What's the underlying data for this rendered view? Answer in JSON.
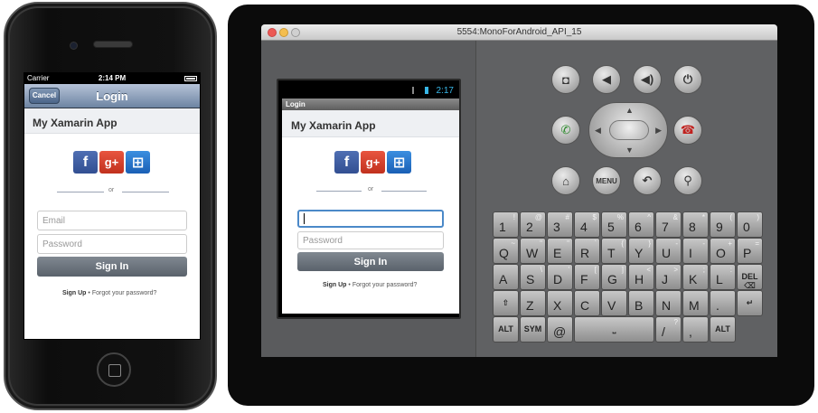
{
  "ios": {
    "status": {
      "carrier": "Carrier",
      "time": "2:14 PM"
    },
    "nav": {
      "title": "Login",
      "cancel_label": "Cancel"
    },
    "app_title": "My Xamarin App",
    "social": {
      "facebook": "f",
      "google": "g+",
      "windows": "⊞"
    },
    "divider_text": "or",
    "email_placeholder": "Email",
    "password_placeholder": "Password",
    "signin_label": "Sign In",
    "links": {
      "signup": "Sign Up",
      "separator": "•",
      "forgot": "Forgot your password?"
    }
  },
  "emulator": {
    "window_title": "5554:MonoForAndroid_API_15",
    "status_time": "2:17",
    "activity_title": "Login",
    "app_title": "My Xamarin App",
    "social": {
      "facebook": "f",
      "google": "g+",
      "windows": "⊞"
    },
    "divider_text": "or",
    "username_value": "",
    "password_placeholder": "Password",
    "signin_label": "Sign In",
    "links": {
      "signup": "Sign Up",
      "separator": "•",
      "forgot": "Forgot your password?"
    },
    "controls": {
      "camera": "camera-icon",
      "vol_down": "volume-down-icon",
      "vol_up": "volume-up-icon",
      "power": "power-icon",
      "call": "call-icon",
      "end": "end-call-icon",
      "home": "home-icon",
      "menu_label": "MENU",
      "back": "back-icon",
      "search": "search-icon"
    },
    "keyboard": {
      "rows": [
        [
          {
            "m": "1",
            "s": "!"
          },
          {
            "m": "2",
            "s": "@"
          },
          {
            "m": "3",
            "s": "#"
          },
          {
            "m": "4",
            "s": "$"
          },
          {
            "m": "5",
            "s": "%"
          },
          {
            "m": "6",
            "s": "^"
          },
          {
            "m": "7",
            "s": "&"
          },
          {
            "m": "8",
            "s": "*"
          },
          {
            "m": "9",
            "s": "("
          },
          {
            "m": "0",
            "s": ")"
          }
        ],
        [
          {
            "m": "Q",
            "s": "~"
          },
          {
            "m": "W",
            "s": "\""
          },
          {
            "m": "E",
            "s": "\""
          },
          {
            "m": "R",
            "s": "`"
          },
          {
            "m": "T",
            "s": "{"
          },
          {
            "m": "Y",
            "s": "}"
          },
          {
            "m": "U",
            "s": "-"
          },
          {
            "m": "I",
            "s": "-"
          },
          {
            "m": "O",
            "s": "+"
          },
          {
            "m": "P",
            "s": "="
          }
        ],
        [
          {
            "m": "A",
            "s": ""
          },
          {
            "m": "S",
            "s": "\\"
          },
          {
            "m": "D",
            "s": "'"
          },
          {
            "m": "F",
            "s": "["
          },
          {
            "m": "G",
            "s": "]"
          },
          {
            "m": "H",
            "s": "<"
          },
          {
            "m": "J",
            "s": ">"
          },
          {
            "m": "K",
            "s": ";"
          },
          {
            "m": "L",
            "s": ":"
          },
          {
            "c": "DEL ⌫"
          }
        ],
        [
          {
            "c": "⇧"
          },
          {
            "m": "Z",
            "s": ""
          },
          {
            "m": "X",
            "s": ""
          },
          {
            "m": "C",
            "s": ""
          },
          {
            "m": "V",
            "s": ""
          },
          {
            "m": "B",
            "s": ""
          },
          {
            "m": "N",
            "s": ""
          },
          {
            "m": "M",
            "s": ""
          },
          {
            "m": ".",
            "s": ""
          },
          {
            "c": "↵"
          }
        ],
        [
          {
            "c": "ALT"
          },
          {
            "c": "SYM"
          },
          {
            "m": "@",
            "s": ""
          },
          {
            "c": "⎵"
          },
          {
            "m": "/",
            "s": "?"
          },
          {
            "m": ",",
            "s": ""
          },
          {
            "c": "ALT"
          }
        ]
      ]
    }
  }
}
